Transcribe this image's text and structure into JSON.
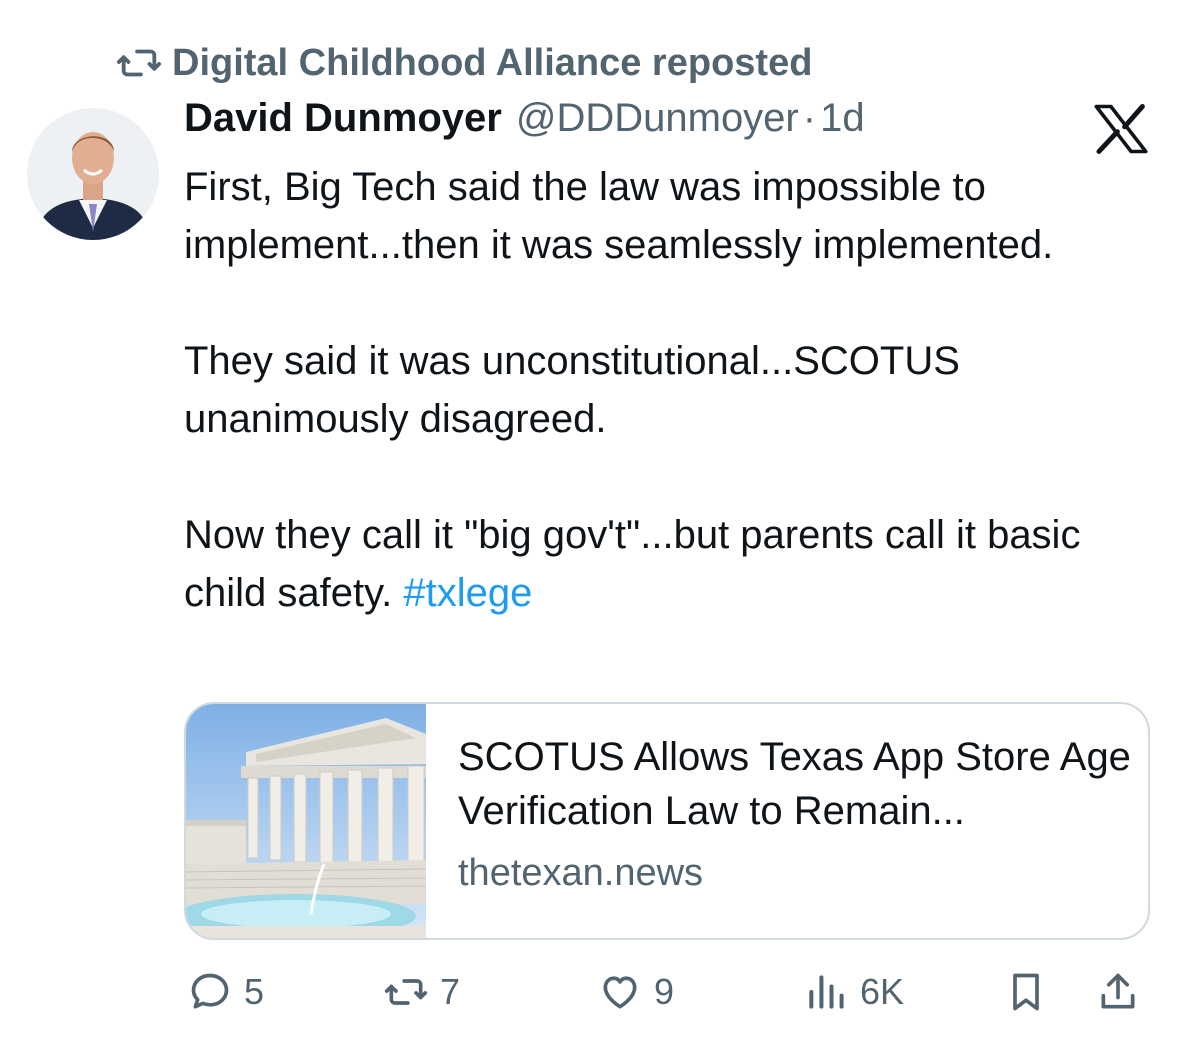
{
  "repost": {
    "label": "Digital Childhood Alliance reposted",
    "icon": "repost-icon"
  },
  "author": {
    "name": "David Dunmoyer",
    "handle": "@DDDunmoyer",
    "separator": "·",
    "time": "1d"
  },
  "brand": {
    "icon": "x-logo-icon"
  },
  "post": {
    "para1": "First, Big Tech said the law was impossible to implement...then it was seamlessly implemented.",
    "para2": "They said it was unconstitutional...SCOTUS unanimously disagreed.",
    "para3": "Now they call it \"big gov't\"...but parents call it basic child safety.",
    "hashtag": "#txlege"
  },
  "link_card": {
    "title": "SCOTUS Allows Texas App Store Age Verification Law to Remain...",
    "domain": "thetexan.news",
    "image": "supreme-court-building"
  },
  "actions": {
    "replies": "5",
    "reposts": "7",
    "likes": "9",
    "views": "6K"
  },
  "colors": {
    "text": "#0f1419",
    "secondary": "#536471",
    "link": "#1d9bf0",
    "border": "#cfd9de"
  }
}
